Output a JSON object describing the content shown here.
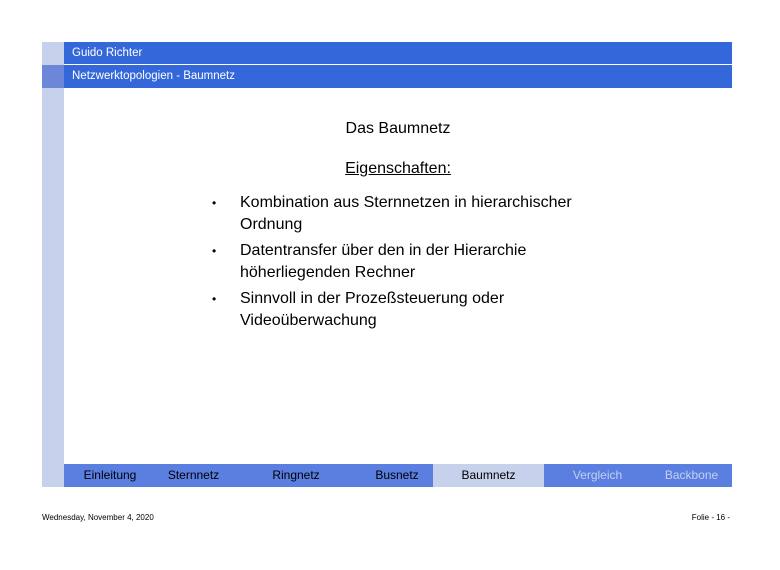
{
  "header": {
    "author": "Guido Richter",
    "topic": "Netzwerktopologien - Baumnetz"
  },
  "slide": {
    "title": "Das Baumnetz",
    "subtitle": "Eigenschaften:",
    "bullets": [
      "Kombination aus Sternnetzen in hierarchischer Ordnung",
      "Datentransfer über den in der Hierarchie höherliegenden Rechner",
      "Sinnvoll in der Prozeßsteuerung oder Videoüberwachung"
    ],
    "bullet_glyph": "•"
  },
  "nav": {
    "items": [
      {
        "label": "Einleitung"
      },
      {
        "label": "Sternnetz"
      },
      {
        "label": "Ringnetz"
      },
      {
        "label": "Busnetz"
      },
      {
        "label": "Baumnetz"
      },
      {
        "label": "Vergleich"
      },
      {
        "label": "Backbone"
      }
    ],
    "active": "Baumnetz"
  },
  "footer": {
    "date": "Wednesday, November 4, 2020",
    "page": "Folie - 16 -"
  },
  "colors": {
    "header_bar": "#3467d9",
    "nav_bar": "#5b7fe0",
    "strip": "#c6d2ec",
    "active_tab": "#c6d2ec"
  }
}
